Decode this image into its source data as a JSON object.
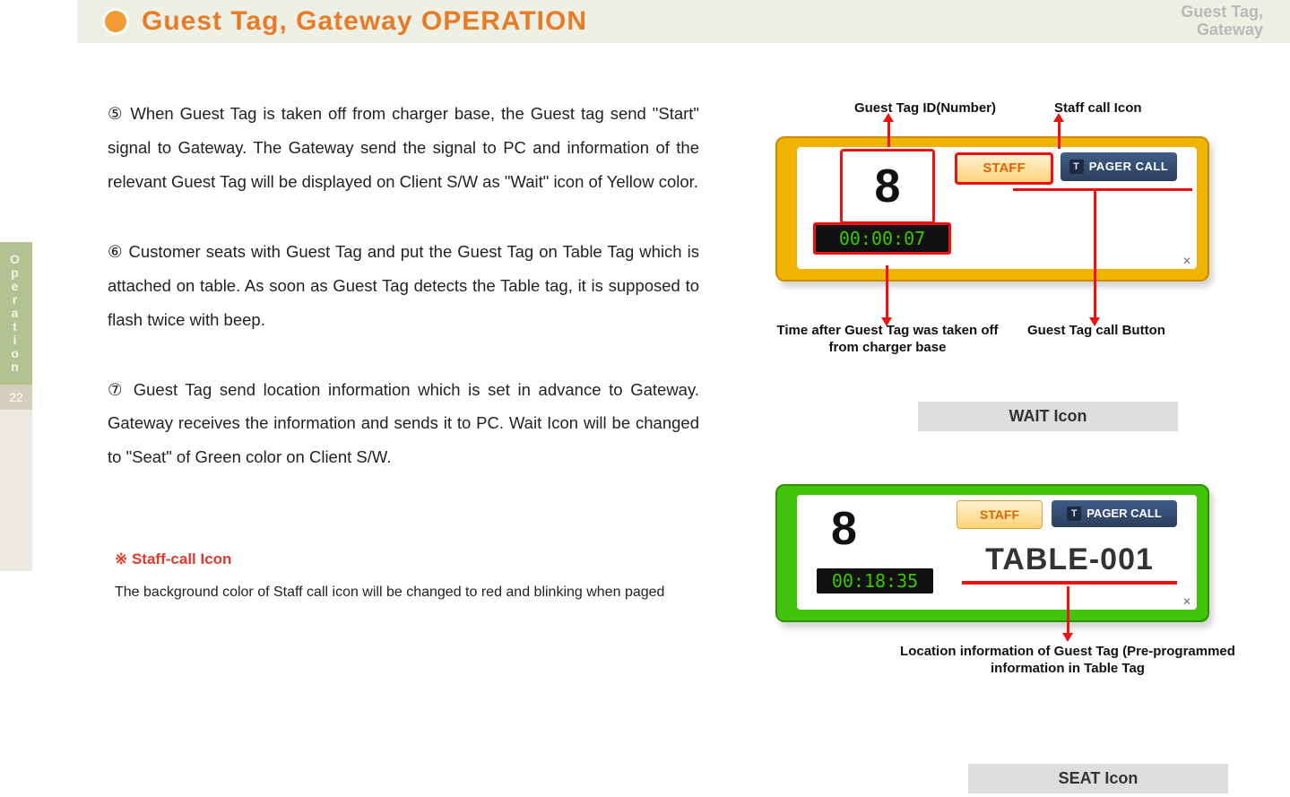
{
  "header": {
    "title": "Guest Tag, Gateway OPERATION",
    "right_line1": "Guest Tag,",
    "right_line2": "Gateway"
  },
  "sidebar": {
    "tab": "Operation",
    "page_number": "22"
  },
  "body": {
    "p1": "⑤ When Guest Tag is taken off from charger base, the Guest tag send \"Start\" signal to Gateway. The Gateway send the signal to PC and information of the relevant Guest Tag will be displayed on Client S/W as \"Wait\" icon of Yellow color.",
    "p2": "⑥ Customer seats with Guest Tag and put the Guest Tag on Table Tag which is attached on table. As soon as Guest Tag detects the Table tag, it is supposed to flash twice with beep.",
    "p3": "⑦ Guest Tag send location information which is set in advance to Gateway. Gateway receives the information and sends it to PC. Wait Icon will be changed to \"Seat\" of Green color on Client S/W."
  },
  "note": {
    "title": "※ Staff-call Icon",
    "text": "The background color of Staff call icon will be changed to red and blinking when paged"
  },
  "wait": {
    "number": "8",
    "timer": "00:00:07",
    "staff_label": "STAFF",
    "pager_label": "PAGER CALL"
  },
  "callouts": {
    "guest_tag_id": "Guest Tag ID(Number)",
    "staff_call_icon": "Staff call Icon",
    "time_after": "Time after Guest Tag was taken off from charger base",
    "guest_tag_call_button": "Guest Tag call Button",
    "wait_icon_label": "WAIT Icon",
    "seat_icon_label": "SEAT Icon",
    "location_info": "Location information of Guest Tag (Pre-programmed information in Table Tag"
  },
  "seat": {
    "number": "8",
    "timer": "00:18:35",
    "staff_label": "STAFF",
    "pager_label": "PAGER CALL",
    "table_name": "TABLE-001"
  }
}
